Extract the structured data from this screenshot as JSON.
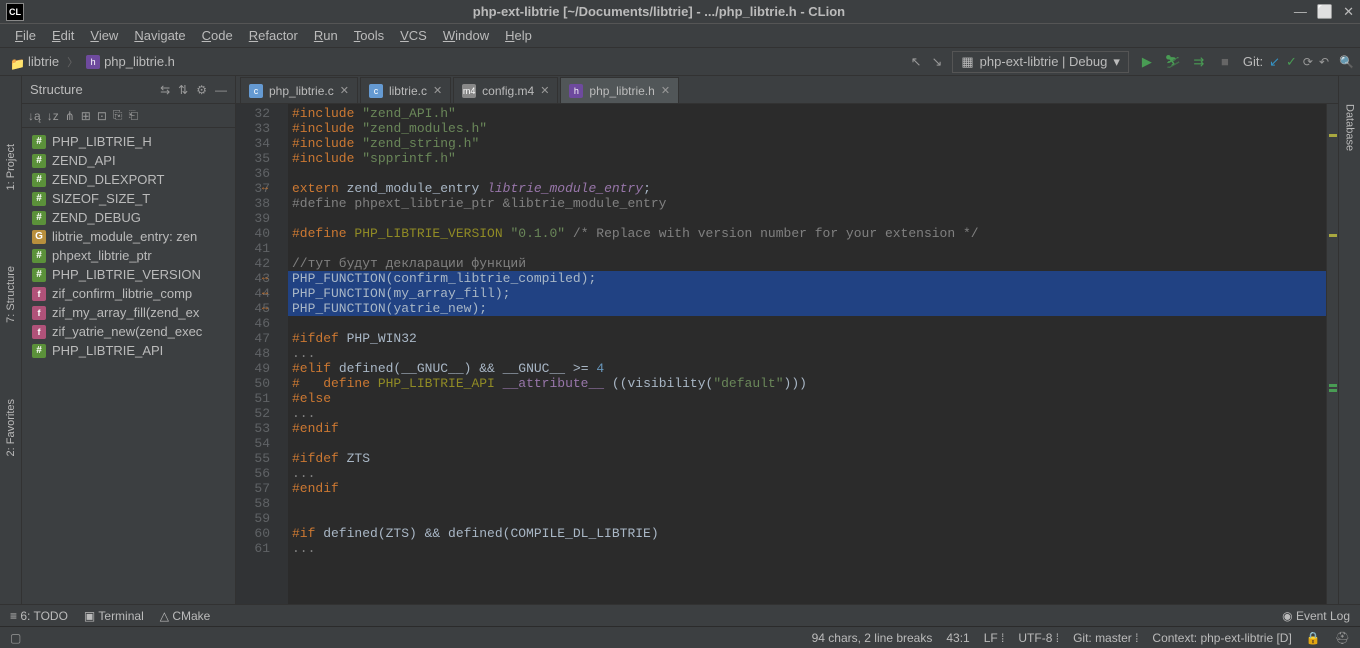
{
  "titlebar": {
    "app_icon": "CL",
    "title": "php-ext-libtrie [~/Documents/libtrie] - .../php_libtrie.h - CLion"
  },
  "menu": [
    "File",
    "Edit",
    "View",
    "Navigate",
    "Code",
    "Refactor",
    "Run",
    "Tools",
    "VCS",
    "Window",
    "Help"
  ],
  "breadcrumb": {
    "folder": "libtrie",
    "file": "php_libtrie.h"
  },
  "navbar": {
    "config": "php-ext-libtrie | Debug",
    "git_label": "Git:"
  },
  "structure": {
    "title": "Structure",
    "items": [
      {
        "type": "d",
        "label": "PHP_LIBTRIE_H"
      },
      {
        "type": "d",
        "label": "ZEND_API"
      },
      {
        "type": "d",
        "label": "ZEND_DLEXPORT"
      },
      {
        "type": "d",
        "label": "SIZEOF_SIZE_T"
      },
      {
        "type": "d",
        "label": "ZEND_DEBUG"
      },
      {
        "type": "g",
        "label": "libtrie_module_entry: zen"
      },
      {
        "type": "d",
        "label": "phpext_libtrie_ptr"
      },
      {
        "type": "d",
        "label": "PHP_LIBTRIE_VERSION"
      },
      {
        "type": "f",
        "label": "zif_confirm_libtrie_comp"
      },
      {
        "type": "f",
        "label": "zif_my_array_fill(zend_ex"
      },
      {
        "type": "f",
        "label": "zif_yatrie_new(zend_exec"
      },
      {
        "type": "d",
        "label": "PHP_LIBTRIE_API"
      }
    ]
  },
  "tabs": [
    {
      "icon": "c",
      "label": "php_libtrie.c",
      "active": false
    },
    {
      "icon": "c",
      "label": "libtrie.c",
      "active": false
    },
    {
      "icon": "m4",
      "label": "config.m4",
      "active": false
    },
    {
      "icon": "h",
      "label": "php_libtrie.h",
      "active": true
    }
  ],
  "side_tabs": {
    "t1": "1: Project",
    "t2": "7: Structure",
    "t3": "2: Favorites"
  },
  "db_tab": "Database",
  "bottom": {
    "todo": "6: TODO",
    "terminal": "Terminal",
    "cmake": "CMake",
    "eventlog": "Event Log"
  },
  "status": {
    "chars": "94 chars, 2 line breaks",
    "pos": "43:1",
    "linesep": "LF",
    "encoding": "UTF-8",
    "branch": "Git: master",
    "context": "Context: php-ext-libtrie [D]"
  },
  "code": {
    "lines": [
      {
        "n": 32,
        "html": "<span class='kw'>#include</span> <span class='str'>\"zend_API.h\"</span>"
      },
      {
        "n": 33,
        "html": "<span class='kw'>#include</span> <span class='str'>\"zend_modules.h\"</span>"
      },
      {
        "n": 34,
        "html": "<span class='kw'>#include</span> <span class='str'>\"zend_string.h\"</span>"
      },
      {
        "n": 35,
        "html": "<span class='kw'>#include</span> <span class='str'>\"spprintf.h\"</span>"
      },
      {
        "n": 36,
        "html": ""
      },
      {
        "n": 37,
        "html": "<span class='kw'>extern</span> <span class='fname'>zend_module_entry</span> <span class='purple'>libtrie_module_entry</span>;",
        "mark": "↔"
      },
      {
        "n": 38,
        "html": "<span class='cmt'>#define phpext_libtrie_ptr &amp;libtrie_module_entry</span>"
      },
      {
        "n": 39,
        "html": ""
      },
      {
        "n": 40,
        "html": "<span class='kw'>#define</span> <span class='macro'>PHP_LIBTRIE_VERSION</span> <span class='str'>\"0.1.0\"</span> <span class='cmt'>/* Replace with version number for your extension */</span>"
      },
      {
        "n": 41,
        "html": ""
      },
      {
        "n": 42,
        "html": "<span class='cmt'>//тут будут декларации функций</span>"
      },
      {
        "n": 43,
        "html": "<span class='fname'>PHP_FUNCTION</span>(<span class='fname'>confirm_libtrie_compiled</span>);",
        "sel": true,
        "mark": "↔"
      },
      {
        "n": 44,
        "html": "<span class='fname'>PHP_FUNCTION</span>(<span class='fname'>my_array_fill</span>);",
        "sel": true,
        "mark": "↔"
      },
      {
        "n": 45,
        "html": "<span class='fname'>PHP_FUNCTION</span>(<span class='fname'>yatrie_new</span>);",
        "sel": true,
        "mark": "↔"
      },
      {
        "n": 46,
        "html": ""
      },
      {
        "n": 47,
        "html": "<span class='kw'>#ifdef</span> PHP_WIN32"
      },
      {
        "n": 48,
        "html": "<span class='fold'>...</span>"
      },
      {
        "n": 49,
        "html": "<span class='kw'>#elif</span> defined(<span class='fname'>__GNUC__</span>) &amp;&amp; <span class='fname'>__GNUC__</span> &gt;= <span class='num'>4</span>"
      },
      {
        "n": 50,
        "html": "<span class='kw'>#   define</span> <span class='macro'>PHP_LIBTRIE_API</span> <span class='attr'>__attribute__</span> ((visibility(<span class='str'>\"default\"</span>)))"
      },
      {
        "n": 51,
        "html": "<span class='kw'>#else</span>"
      },
      {
        "n": 52,
        "html": "<span class='fold'>...</span>"
      },
      {
        "n": 53,
        "html": "<span class='kw'>#endif</span>"
      },
      {
        "n": 54,
        "html": ""
      },
      {
        "n": 55,
        "html": "<span class='kw'>#ifdef</span> ZTS"
      },
      {
        "n": 56,
        "html": "<span class='fold'>...</span>"
      },
      {
        "n": 57,
        "html": "<span class='kw'>#endif</span>"
      },
      {
        "n": 58,
        "html": ""
      },
      {
        "n": 59,
        "html": ""
      },
      {
        "n": 60,
        "html": "<span class='kw'>#if</span> defined(ZTS) &amp;&amp; defined(COMPILE_DL_LIBTRIE)"
      },
      {
        "n": 61,
        "html": "<span class='fold'>...</span>"
      }
    ]
  }
}
